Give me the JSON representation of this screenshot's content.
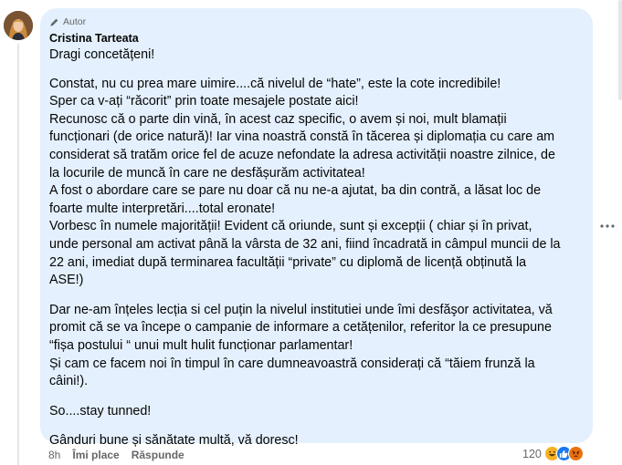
{
  "comment": {
    "badge_label": "Autor",
    "author": "Cristina Tarteata",
    "paragraphs": [
      [
        "Dragi concetățeni!"
      ],
      [
        "Constat, nu cu prea mare uimire....că nivelul de “hate”, este la cote incredibile!",
        "Sper ca v-ați “răcorit” prin toate mesajele postate aici!",
        "Recunosc că o parte din vină, în acest caz specific, o avem și noi, mult blamații",
        "funcționari (de orice natură)! Iar vina noastră constă în tăcerea și diplomația cu care am",
        "considerat să tratăm orice fel de acuze nefondate la adresa activității noastre zilnice, de",
        "la locurile de muncă în care ne desfășurăm activitatea!",
        "A fost o abordare care se pare nu doar că nu ne-a ajutat, ba din contră, a lăsat loc de",
        "foarte multe interpretări....total eronate!",
        "Vorbesc în numele majorității! Evident că oriunde, sunt și excepții ( chiar și în privat,",
        "unde personal am activat până la vârsta de 32 ani, fiind încadrată in câmpul muncii de la",
        "22 ani, imediat după terminarea facultății “private” cu diplomă de licență obținută la",
        "ASE!)"
      ],
      [
        "Dar ne-am înțeles lecția si cel puțin la nivelul institutiei unde îmi desfăşor activitatea, vă",
        "promit că se va începe o campanie de informare a cetățenilor, referitor la ce presupune",
        "“fișa postului “ unui mult hulit funcționar parlamentar!",
        "Și cam ce facem noi în timpul în care dumneavoastră considerați că “tăiem frunză la",
        "câini!)."
      ],
      [
        "So....stay tunned!"
      ],
      [
        "Gânduri bune și sănătate multă, vă doresc!"
      ]
    ]
  },
  "actions": {
    "time": "8h",
    "like": "Îmi place",
    "reply": "Răspunde"
  },
  "reactions": {
    "count": "120",
    "icons": [
      "haha-icon",
      "like-icon",
      "angry-icon"
    ],
    "colors": {
      "haha": "#f7b125",
      "like": "#1877f2",
      "angry": "#e9710f"
    }
  },
  "colors": {
    "bubble": "#e4f0fd",
    "secondary_text": "#65676b"
  }
}
